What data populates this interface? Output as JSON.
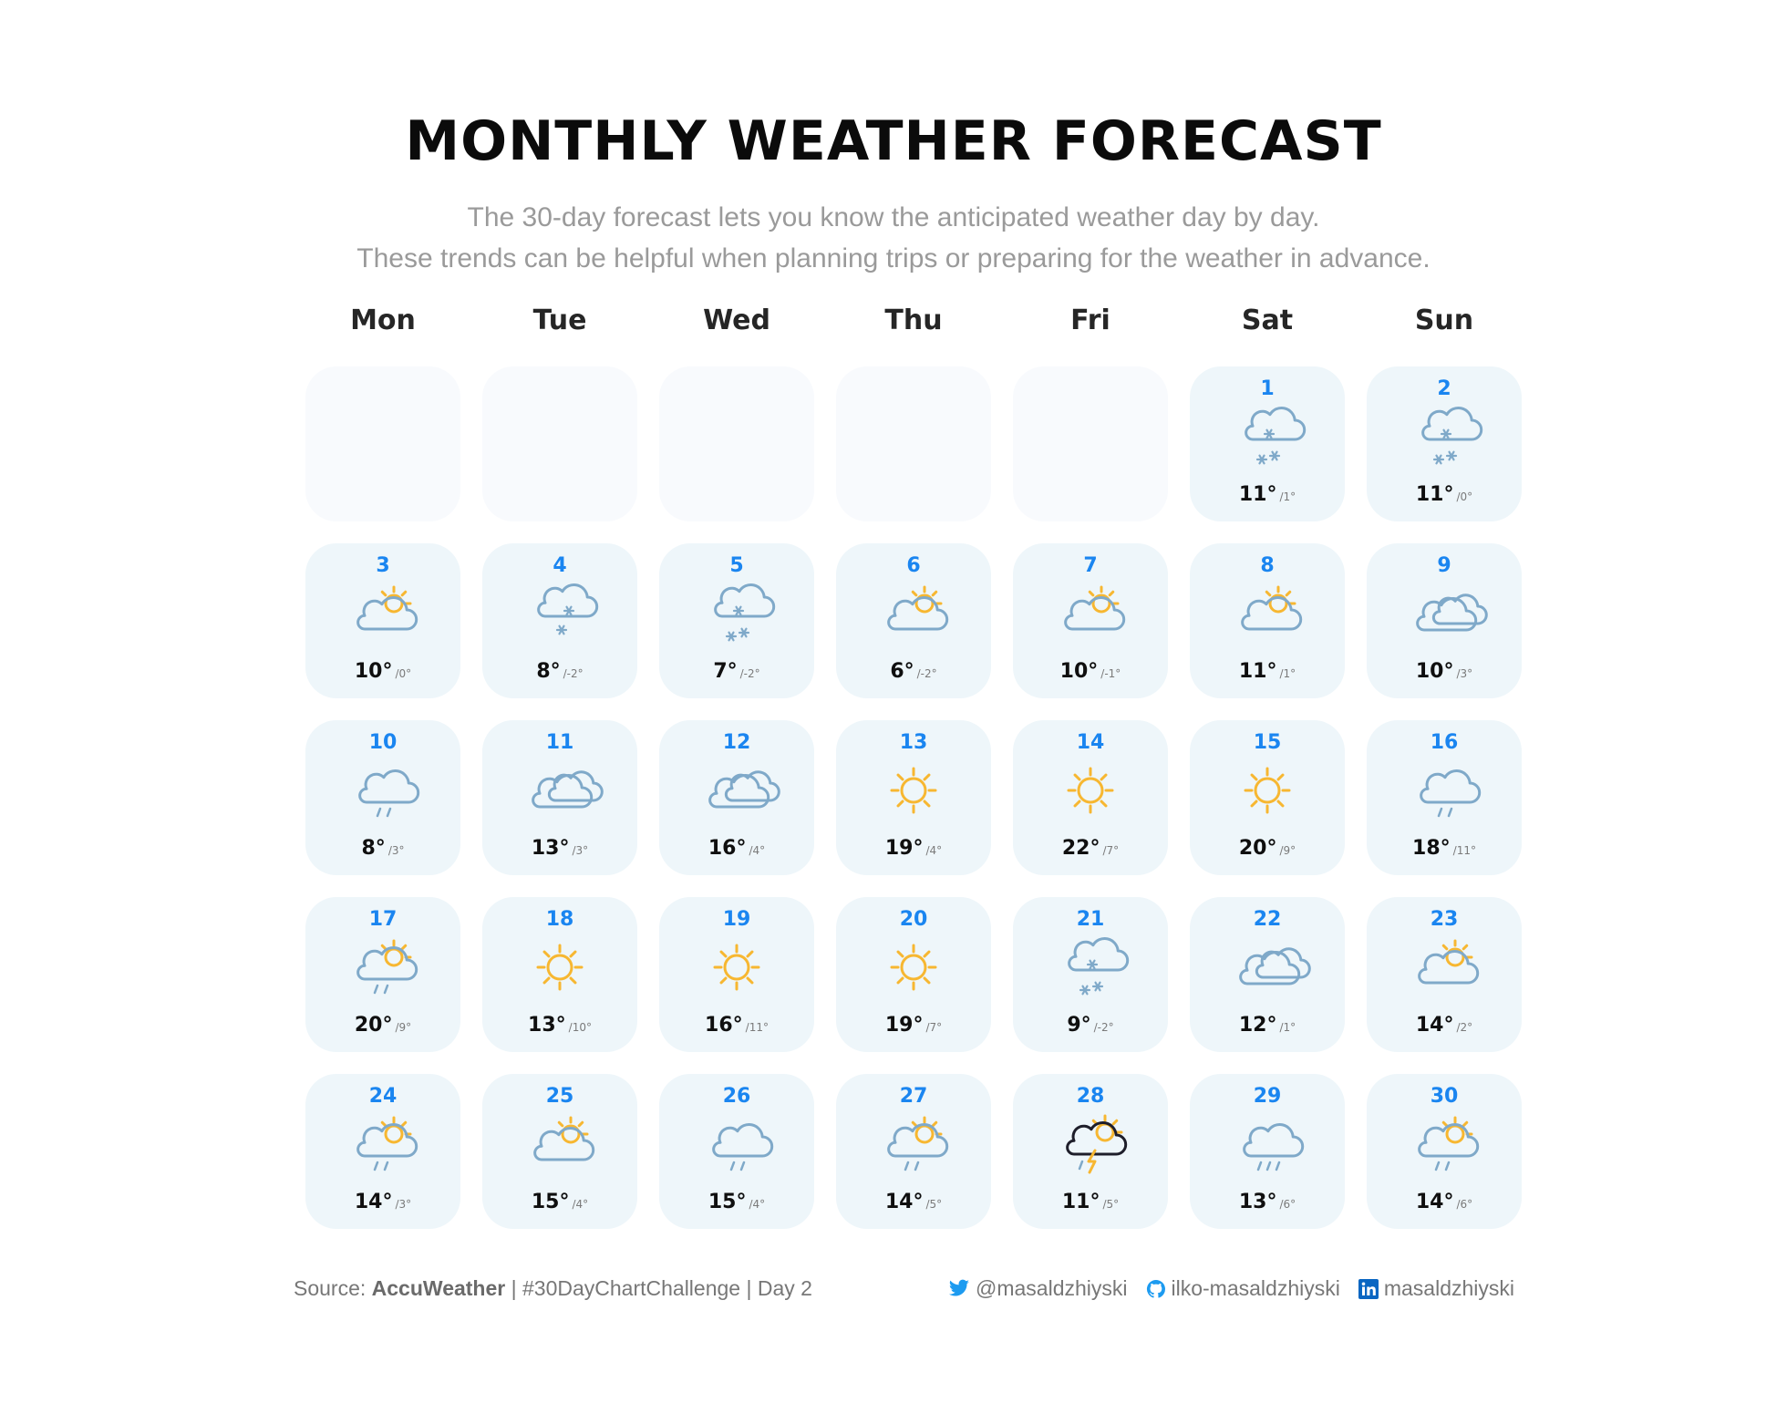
{
  "header": {
    "title": "MONTHLY WEATHER FORECAST",
    "subtitle_line1": "The 30-day forecast lets you know the anticipated weather day by day.",
    "subtitle_line2": "These trends can be helpful when planning trips or preparing for the weather in advance."
  },
  "chart_data": {
    "type": "table",
    "weekdays": [
      "Mon",
      "Tue",
      "Wed",
      "Thu",
      "Fri",
      "Sat",
      "Sun"
    ],
    "first_weekday_index": 5,
    "days": [
      {
        "day": "1",
        "hi": "11°",
        "lo": "/1°",
        "icon": "snow"
      },
      {
        "day": "2",
        "hi": "11°",
        "lo": "/0°",
        "icon": "snow"
      },
      {
        "day": "3",
        "hi": "10°",
        "lo": "/0°",
        "icon": "partly-cloudy"
      },
      {
        "day": "4",
        "hi": "8°",
        "lo": "/-2°",
        "icon": "snow-light"
      },
      {
        "day": "5",
        "hi": "7°",
        "lo": "/-2°",
        "icon": "snow"
      },
      {
        "day": "6",
        "hi": "6°",
        "lo": "/-2°",
        "icon": "partly-cloudy"
      },
      {
        "day": "7",
        "hi": "10°",
        "lo": "/-1°",
        "icon": "partly-cloudy"
      },
      {
        "day": "8",
        "hi": "11°",
        "lo": "/1°",
        "icon": "partly-cloudy"
      },
      {
        "day": "9",
        "hi": "10°",
        "lo": "/3°",
        "icon": "cloudy"
      },
      {
        "day": "10",
        "hi": "8°",
        "lo": "/3°",
        "icon": "rain"
      },
      {
        "day": "11",
        "hi": "13°",
        "lo": "/3°",
        "icon": "cloudy"
      },
      {
        "day": "12",
        "hi": "16°",
        "lo": "/4°",
        "icon": "cloudy"
      },
      {
        "day": "13",
        "hi": "19°",
        "lo": "/4°",
        "icon": "sunny"
      },
      {
        "day": "14",
        "hi": "22°",
        "lo": "/7°",
        "icon": "sunny"
      },
      {
        "day": "15",
        "hi": "20°",
        "lo": "/9°",
        "icon": "sunny"
      },
      {
        "day": "16",
        "hi": "18°",
        "lo": "/11°",
        "icon": "rain"
      },
      {
        "day": "17",
        "hi": "20°",
        "lo": "/9°",
        "icon": "partly-cloudy-rain"
      },
      {
        "day": "18",
        "hi": "13°",
        "lo": "/10°",
        "icon": "sunny"
      },
      {
        "day": "19",
        "hi": "16°",
        "lo": "/11°",
        "icon": "sunny"
      },
      {
        "day": "20",
        "hi": "19°",
        "lo": "/7°",
        "icon": "sunny"
      },
      {
        "day": "21",
        "hi": "9°",
        "lo": "/-2°",
        "icon": "snow"
      },
      {
        "day": "22",
        "hi": "12°",
        "lo": "/1°",
        "icon": "cloudy"
      },
      {
        "day": "23",
        "hi": "14°",
        "lo": "/2°",
        "icon": "partly-cloudy"
      },
      {
        "day": "24",
        "hi": "14°",
        "lo": "/3°",
        "icon": "partly-cloudy-rain"
      },
      {
        "day": "25",
        "hi": "15°",
        "lo": "/4°",
        "icon": "partly-cloudy"
      },
      {
        "day": "26",
        "hi": "15°",
        "lo": "/4°",
        "icon": "rain"
      },
      {
        "day": "27",
        "hi": "14°",
        "lo": "/5°",
        "icon": "partly-cloudy-rain"
      },
      {
        "day": "28",
        "hi": "11°",
        "lo": "/5°",
        "icon": "thunderstorm"
      },
      {
        "day": "29",
        "hi": "13°",
        "lo": "/6°",
        "icon": "rain-heavy"
      },
      {
        "day": "30",
        "hi": "14°",
        "lo": "/6°",
        "icon": "partly-cloudy-rain"
      }
    ]
  },
  "footer": {
    "source_prefix": "Source: ",
    "source_name": "AccuWeather",
    "source_suffix": " | #30DayChartChallenge | Day 2",
    "twitter": "@masaldzhiyski",
    "github": "ilko-masaldzhiyski",
    "linkedin": "masaldzhiyski"
  },
  "colors": {
    "day_number": "#1a85f0",
    "cell_background": "#eef6fa",
    "empty_cell_background": "#f8fafd",
    "cloud_stroke": "#7fa9c9",
    "sun": "#f7b731",
    "twitter": "#1d9bf0",
    "linkedin": "#0a66c2"
  }
}
